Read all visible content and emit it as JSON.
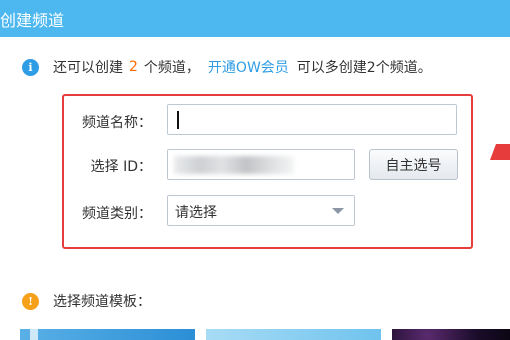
{
  "window": {
    "title": "创建频道"
  },
  "info": {
    "prefix": "还可以创建",
    "count": "2",
    "suffix": "个频道，",
    "vip_link": "开通OW会员",
    "tail": "可以多创建2个频道。"
  },
  "form": {
    "name_label": "频道名称：",
    "name_value": "",
    "id_label": "选择 ID：",
    "pick_button": "自主选号",
    "category_label": "频道类别：",
    "category_value": "请选择"
  },
  "template": {
    "label": "选择频道模板："
  },
  "colors": {
    "titlebar": "#4cb8ef",
    "accent": "#2f9de6",
    "count": "#ff6a00",
    "highlight_border": "#e63c3c",
    "warning": "#f7a11a"
  },
  "icons": [
    "info-icon",
    "red-arrow-icon",
    "warning-icon",
    "chevron-down-icon"
  ]
}
